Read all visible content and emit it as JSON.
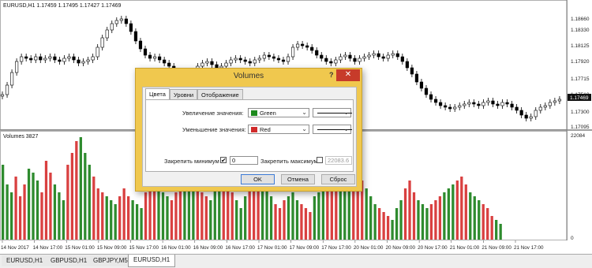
{
  "chart": {
    "title": "EURUSD,H1  1.17459 1.17495 1.17427 1.17469",
    "current_price_label": "1.17469",
    "price_axis": [
      "1.18660",
      "1.18330",
      "1.18125",
      "1.17920",
      "1.17715",
      "1.17510",
      "1.17300",
      "1.17095"
    ],
    "indicator_label": "Volumes 3827",
    "volume_axis_top": "22084",
    "volume_axis_bottom": "0",
    "time_axis": [
      "14 Nov 2017",
      "14 Nov 17:00",
      "15 Nov 01:00",
      "15 Nov 09:00",
      "15 Nov 17:00",
      "16 Nov 01:00",
      "16 Nov 09:00",
      "16 Nov 17:00",
      "17 Nov 01:00",
      "17 Nov 09:00",
      "17 Nov 17:00",
      "20 Nov 01:00",
      "20 Nov 09:00",
      "20 Nov 17:00",
      "21 Nov 01:00",
      "21 Nov 09:00",
      "21 Nov 17:00"
    ],
    "colors": {
      "up_volume": "#2e8b2e",
      "down_volume": "#d94040",
      "candle": "#000000",
      "price_line": "#d03030"
    }
  },
  "tabs": [
    "EURUSD,H1",
    "GBPUSD,H1",
    "GBPJPY,M5",
    "EURUSD,H1"
  ],
  "active_tab": 3,
  "dialog": {
    "title": "Volumes",
    "help": "?",
    "close": "✕",
    "tabs": [
      "Цвета",
      "Уровни",
      "Отображение"
    ],
    "rows": [
      {
        "label": "Увеличение значения:",
        "color_name": "Green",
        "color": "#1e8a1e"
      },
      {
        "label": "Уменьшение значения:",
        "color_name": "Red",
        "color": "#d02a2a"
      }
    ],
    "fix_min_label": "Закрепить минимум",
    "fix_min_checked": true,
    "fix_min_value": "0",
    "fix_max_label": "Закрепить максимум",
    "fix_max_checked": false,
    "fix_max_value": "22083.6",
    "buttons": {
      "ok": "OK",
      "cancel": "Отмена",
      "reset": "Сброс"
    }
  }
}
